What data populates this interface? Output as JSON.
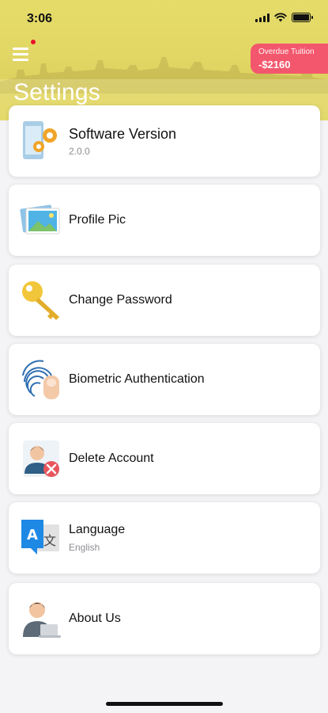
{
  "status": {
    "time": "3:06"
  },
  "header": {
    "title": "Settings",
    "tuition": {
      "label": "Overdue Tuition",
      "amount": "-$2160"
    }
  },
  "items": [
    {
      "label": "Software Version",
      "sub": "2.0.0",
      "icon": "software-settings-icon"
    },
    {
      "label": "Profile Pic",
      "icon": "picture-icon"
    },
    {
      "label": "Change Password",
      "icon": "key-icon"
    },
    {
      "label": "Biometric Authentication",
      "icon": "fingerprint-icon"
    },
    {
      "label": "Delete Account",
      "sub": "",
      "icon": "delete-user-icon"
    },
    {
      "label": "Language",
      "sub": "English",
      "icon": "translate-icon"
    },
    {
      "label": "About Us",
      "icon": "person-laptop-icon"
    }
  ],
  "colors": {
    "header": "#e2d766",
    "tuition_badge": "#f3576d",
    "notification_dot": "#e8132a"
  }
}
